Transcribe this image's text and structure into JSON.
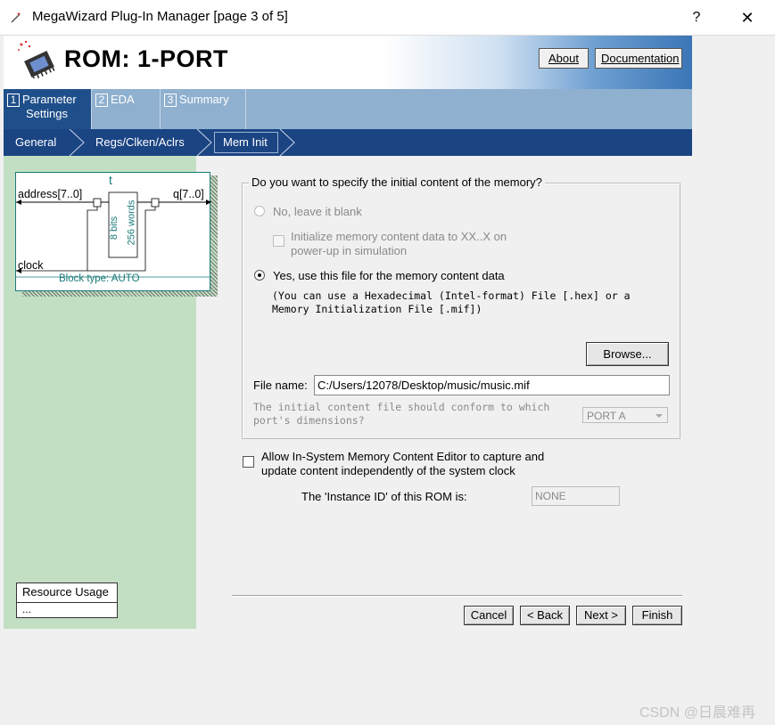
{
  "window": {
    "title": "MegaWizard Plug-In Manager [page 3 of 5]",
    "help_label": "?",
    "close_label": "✕"
  },
  "header": {
    "title": "ROM: 1-PORT",
    "about_label": "About",
    "documentation_label": "Documentation"
  },
  "tabs": [
    {
      "num": "1",
      "line1": "Parameter",
      "line2": "Settings"
    },
    {
      "num": "2",
      "line1": "EDA",
      "line2": ""
    },
    {
      "num": "3",
      "line1": "Summary",
      "line2": ""
    }
  ],
  "steps": [
    {
      "label": "General"
    },
    {
      "label": "Regs/Clken/Aclrs"
    },
    {
      "label": "Mem Init"
    }
  ],
  "block_diagram": {
    "name": "t",
    "address_port": "address[7..0]",
    "q_port": "q[7..0]",
    "clock_port": "clock",
    "bits_label": "8 bits",
    "words_label": "256 words",
    "block_type": "Block type: AUTO"
  },
  "resource_usage": {
    "title": "Resource Usage",
    "value": "..."
  },
  "memory_init": {
    "question": "Do you want to specify the initial content of the memory?",
    "option_no": "No, leave it blank",
    "option_no_selected": false,
    "init_checkbox_line1": "Initialize memory content data to XX..X on",
    "init_checkbox_line2": "power-up in simulation",
    "option_yes": "Yes, use this file for the memory content data",
    "option_yes_selected": true,
    "hint_line1": "(You can use a Hexadecimal (Intel-format) File [.hex] or a",
    "hint_line2": "Memory Initialization File [.mif])",
    "browse_label": "Browse...",
    "file_name_label": "File name:",
    "file_name_value": "C:/Users/12078/Desktop/music/music.mif",
    "conform_line1": "The initial content file should conform to which",
    "conform_line2": "port's dimensions?",
    "port_value": "PORT A"
  },
  "isme": {
    "checkbox_line1": "Allow In-System Memory Content Editor to capture and",
    "checkbox_line2": "update content independently of the system clock",
    "checked": false,
    "instance_label": "The 'Instance ID' of this ROM is:",
    "instance_value": "NONE"
  },
  "footer": {
    "cancel_label": "Cancel",
    "back_label": "< Back",
    "next_label": "Next >",
    "finish_label": "Finish"
  },
  "watermark": "CSDN @日晨难再"
}
